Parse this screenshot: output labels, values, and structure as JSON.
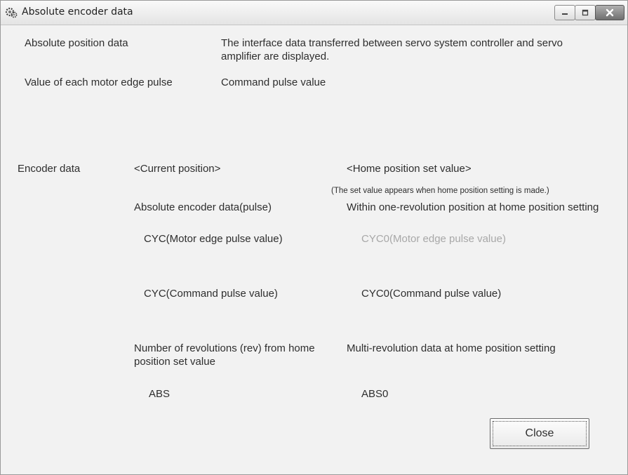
{
  "window": {
    "title": "Absolute encoder data",
    "icon": "gear-cog-icon"
  },
  "caption_buttons": {
    "minimize_icon": "minimize-icon",
    "maximize_icon": "maximize-icon",
    "close_icon": "close-x-icon"
  },
  "info": {
    "absolute_position_label": "Absolute position data",
    "absolute_position_desc": "The interface data transferred between servo system controller and servo amplifier are displayed.",
    "motor_edge_label": "Value of each motor edge pulse",
    "motor_edge_value": "Command pulse value"
  },
  "encoder": {
    "section_label": "Encoder data",
    "current_header": "<Current position>",
    "home_header": "<Home position set value>",
    "home_note": "(The set value appears when home position setting is made.)",
    "abs_encoder_label": "Absolute encoder data(pulse)",
    "within_rev_label": "Within one-revolution position at home position setting",
    "cyc_motor_label": "CYC(Motor edge pulse value)",
    "cyc0_motor_label": "CYC0(Motor edge pulse value)",
    "cyc_command_label": "CYC(Command pulse value)",
    "cyc0_command_label": "CYC0(Command pulse value)",
    "num_rev_label": "Number of revolutions (rev) from home position set value",
    "multi_rev_label": "Multi-revolution data at home position setting",
    "abs_label": "ABS",
    "abs0_label": "ABS0"
  },
  "buttons": {
    "close_label": "Close"
  }
}
